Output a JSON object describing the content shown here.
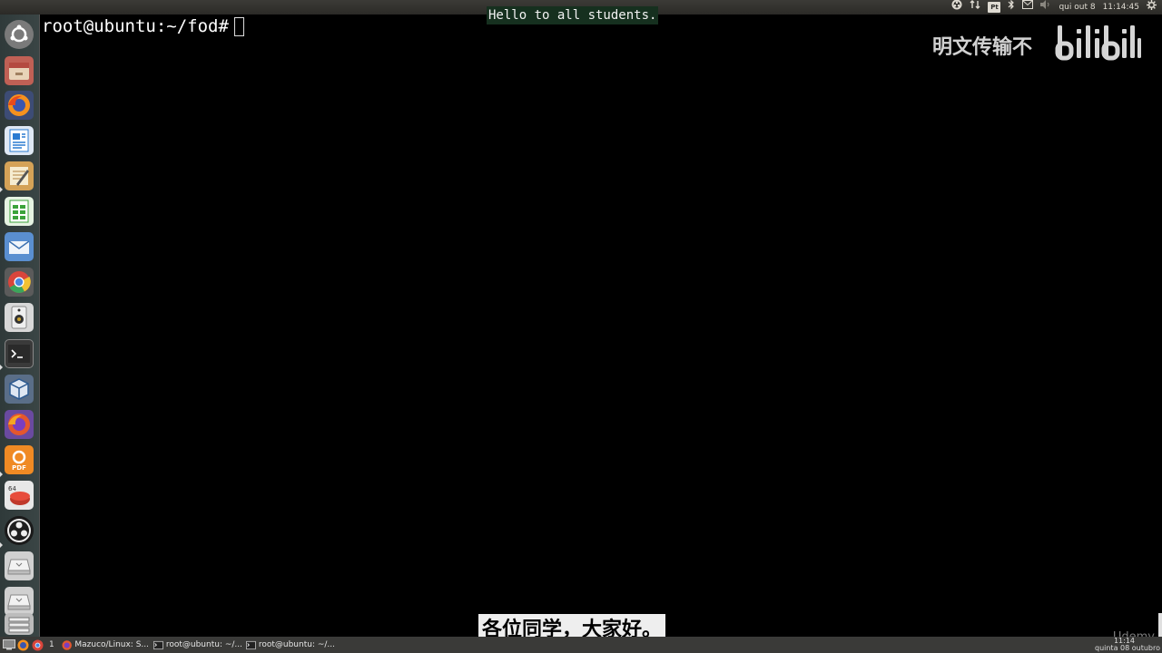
{
  "top_panel": {
    "date": "qui out 8",
    "time": "11:14:45",
    "keyboard_layout": "Pt",
    "icons": [
      "obs-icon",
      "network-icon",
      "keyboard-layout-icon",
      "bluetooth-icon",
      "mail-icon",
      "volume-icon",
      "gear-icon"
    ]
  },
  "terminal": {
    "prompt": "root@ubuntu:~/fod#"
  },
  "captions": {
    "top": "Hello to all students.",
    "bottom": "各位同学，大家好。"
  },
  "watermark": {
    "text": "明文传输不",
    "logo": "bilibili"
  },
  "launcher": {
    "icons": [
      {
        "name": "ubuntu-dash-icon",
        "color": "#6c6c6c"
      },
      {
        "name": "files-icon",
        "color": "#b5534a"
      },
      {
        "name": "firefox-icon",
        "color": "#e66a16"
      },
      {
        "name": "writer-icon",
        "color": "#2b7bd1"
      },
      {
        "name": "text-editor-icon",
        "color": "#c9903a"
      },
      {
        "name": "calc-icon",
        "color": "#3ba33b"
      },
      {
        "name": "mail-client-icon",
        "color": "#3a86d6"
      },
      {
        "name": "chrome-icon",
        "color": "#d9453b"
      },
      {
        "name": "speaker-icon",
        "color": "#b8b8b8"
      },
      {
        "name": "terminal-icon",
        "color": "#2c2c2c"
      },
      {
        "name": "virtualbox-icon",
        "color": "#4a78b0"
      },
      {
        "name": "firefox-dev-icon",
        "color": "#e4572e"
      },
      {
        "name": "pdf-icon",
        "color": "#f08a24"
      },
      {
        "name": "ruby-icon",
        "color": "#c0392b"
      },
      {
        "name": "obs-icon",
        "color": "#1e1e1e"
      },
      {
        "name": "drive-icon",
        "color": "#cfcfcf"
      },
      {
        "name": "drive-2-icon",
        "color": "#cfcfcf"
      },
      {
        "name": "trash-icon",
        "color": "#9a9a9a"
      }
    ]
  },
  "taskbar": {
    "workspace": "1",
    "windows": [
      {
        "label": "Mazuco/Linux: S..."
      },
      {
        "label": "root@ubuntu: ~/..."
      },
      {
        "label": "root@ubuntu: ~/..."
      }
    ],
    "clock": "11:14",
    "date": "quinta 08 outubro"
  },
  "udemy": "Udemy"
}
